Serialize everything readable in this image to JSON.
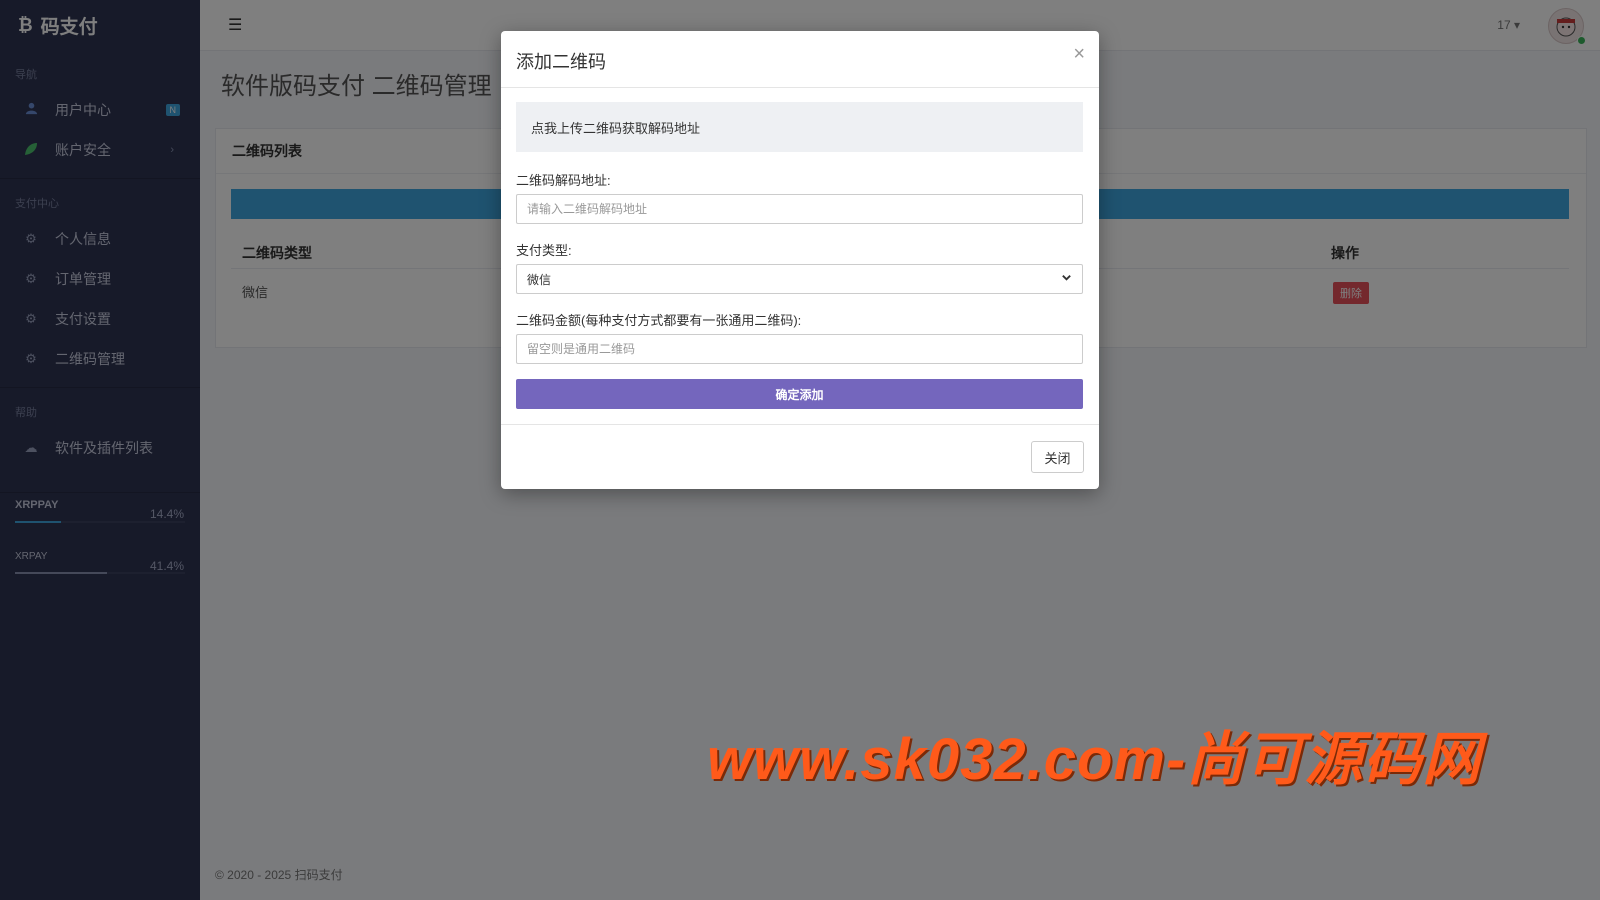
{
  "brand": {
    "logo_icon": "bitcoin-icon",
    "name": "码支付"
  },
  "sidebar": {
    "sections": [
      {
        "header": "导航"
      },
      {
        "header": "支付中心"
      },
      {
        "header": "帮助"
      }
    ],
    "items": [
      {
        "label": "用户中心",
        "icon": "user-icon",
        "badge": "N"
      },
      {
        "label": "账户安全",
        "icon": "leaf-icon",
        "caret": "›"
      },
      {
        "label": "个人信息",
        "icon": "gear-icon"
      },
      {
        "label": "订单管理",
        "icon": "gear-icon"
      },
      {
        "label": "支付设置",
        "icon": "gear-icon"
      },
      {
        "label": "二维码管理",
        "icon": "gear-icon"
      },
      {
        "label": "软件及插件列表",
        "icon": "cloud-icon"
      }
    ],
    "progress": [
      {
        "name": "XRPPAY",
        "value": "14.4%",
        "fraction": 0.27
      },
      {
        "name": "XRPAY",
        "value": "41.4%",
        "fraction": 0.54
      }
    ]
  },
  "topbar": {
    "menu_icon": "☰",
    "user_number": "17 ▾",
    "avatar_icon": "avatar-icon"
  },
  "page": {
    "title": "软件版码支付 二维码管理",
    "card_title": "二维码列表",
    "columns": {
      "type": "二维码类型",
      "action": "操作"
    },
    "rows": [
      {
        "type": "微信",
        "action": "删除"
      }
    ],
    "footer": "© 2020 - 2025 扫码支付"
  },
  "modal": {
    "title": "添加二维码",
    "close_symbol": "×",
    "upload_text": "点我上传二维码获取解码地址",
    "decode_label": "二维码解码地址:",
    "decode_placeholder": "请输入二维码解码地址",
    "pay_type_label": "支付类型:",
    "pay_type_value": "微信",
    "amount_label": "二维码金额(每种支付方式都要有一张通用二维码):",
    "amount_placeholder": "留空则是通用二维码",
    "submit_label": "确定添加",
    "close_label": "关闭"
  },
  "watermark": "www.sk032.com-尚可源码网",
  "colors": {
    "sidebar": "#2f3553",
    "accent_blue": "#3fa7e0",
    "submit_purple": "#7466bd",
    "danger": "#e8505b",
    "watermark": "#ff5a1a"
  }
}
